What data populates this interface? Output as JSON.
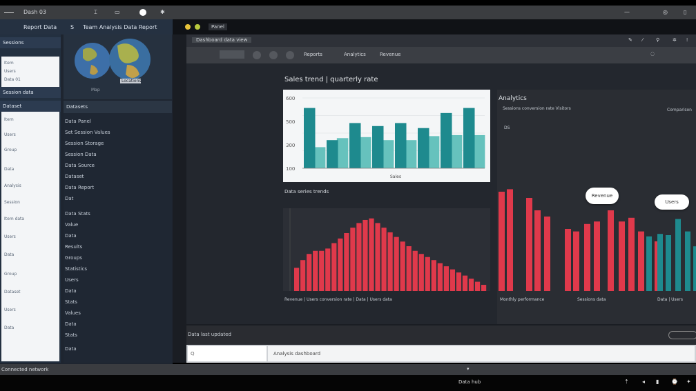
{
  "system_bar": {
    "app_title": "Dash 03",
    "icons": [
      "menu-icon",
      "cursor-icon",
      "window-icon",
      "record-dot-icon",
      "settings-icon",
      "minimize-icon",
      "restore-icon",
      "close-icon"
    ]
  },
  "left_panel": {
    "header_left": "Report Data",
    "header_mid": "S",
    "header_right": "Team Analysis Data Report",
    "side_list_header_1": "Sessions",
    "side_list_header_2": "Session data",
    "side_list_header_3": "Dataset",
    "white_box_items_1": [
      "Item",
      "Users",
      "Data 01"
    ],
    "white_box_items_2": [
      "Item",
      "Users",
      "Group",
      "Data",
      "Analysis",
      "Session",
      "Item data",
      "Users",
      "Data",
      "Group",
      "Dataset",
      "Users",
      "Data"
    ],
    "globe_caption": "Map",
    "globe_label": "Locations",
    "mid_list_header": "Datasets",
    "mid_list_rows": [
      "Data Panel",
      "Set Session Values",
      "Session Storage",
      "Session Data",
      "Data Source",
      "Dataset",
      "Data Report",
      "Dat",
      "Data Stats",
      "Value",
      "Data",
      "Results",
      "Groups",
      "Statistics",
      "Users",
      "Data",
      "Stats",
      "Values",
      "Data",
      "Stats",
      "Data"
    ]
  },
  "main_window": {
    "window_title": "Panel",
    "tab_label": "Dashboard data view",
    "toolbar_items": [
      "Reports",
      "Analytics",
      "Revenue"
    ],
    "chart1_title": "Sales trend | quarterly rate",
    "chart2_title": "Data series trends",
    "chart2_caption": "Revenue | Users conversion rate | Data | Users data",
    "right_panel_title": "Analytics",
    "right_panel_subtitle": "Sessions conversion rate Visitors",
    "right_panel_chip": "Comparison",
    "right_panel_small": "DS",
    "bubble_1": "Revenue",
    "bubble_2": "Users",
    "chart3_caption_1": "Monthly performance",
    "chart3_caption_2": "Sessions data",
    "chart3_caption_3": "Data | Users",
    "status_text": "Data last updated",
    "input_left": "Q",
    "input_value": "Analysis dashboard",
    "bottom_status": "Connected network",
    "dock_label": "Data hub"
  },
  "colors": {
    "teal_dark": "#1e8a8e",
    "teal_light": "#66c2bd",
    "red": "#e0394b",
    "bg_panel": "#1e2530"
  },
  "chart_data": [
    {
      "type": "bar",
      "title": "Sales trend | quarterly rate",
      "xlabel": "Sales",
      "ylabels": [
        "100",
        "300",
        "500",
        "600"
      ],
      "ylim": [
        0,
        700
      ],
      "series": [
        {
          "values": [
            600,
            280,
            450,
            420,
            450,
            400,
            550,
            600
          ]
        },
        {
          "values": [
            210,
            300,
            310,
            280,
            280,
            320,
            330,
            330
          ]
        }
      ]
    },
    {
      "type": "bar",
      "title": "Data series trends",
      "values": [
        30,
        40,
        48,
        52,
        52,
        55,
        62,
        68,
        75,
        82,
        88,
        92,
        94,
        88,
        82,
        76,
        70,
        64,
        58,
        52,
        48,
        44,
        40,
        36,
        32,
        28,
        24,
        20,
        16,
        12,
        8
      ],
      "ylim": [
        0,
        100
      ]
    },
    {
      "type": "bar",
      "series": [
        {
          "name": "Revenue",
          "values": [
            80,
            82,
            75,
            65,
            60,
            50,
            48,
            54,
            56,
            65,
            56,
            59,
            48,
            40
          ]
        },
        {
          "name": "Users",
          "values": [
            44,
            46,
            45,
            58,
            48,
            36
          ]
        }
      ],
      "ylim": [
        0,
        100
      ]
    }
  ]
}
